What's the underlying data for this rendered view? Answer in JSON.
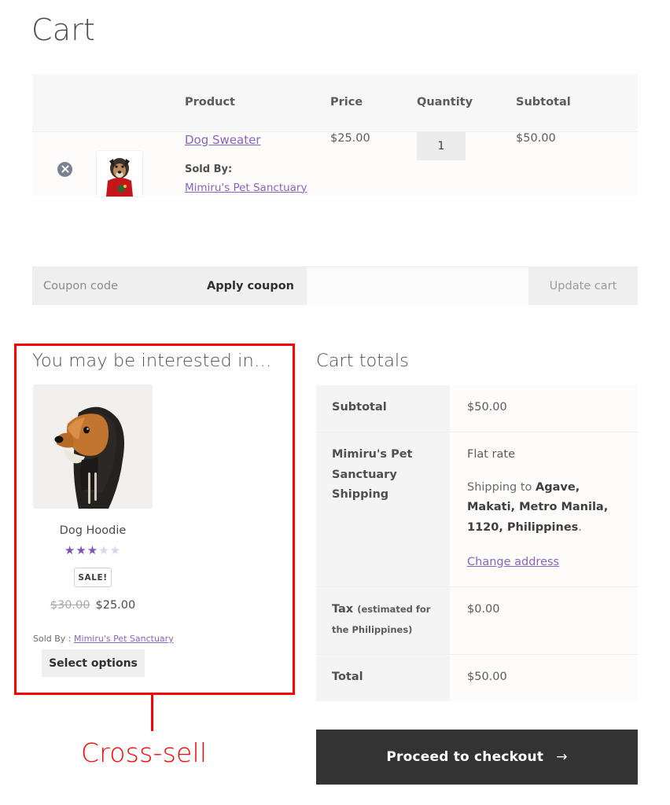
{
  "page": {
    "title": "Cart"
  },
  "cart_table": {
    "headers": [
      "",
      "",
      "Product",
      "Price",
      "Quantity",
      "Subtotal"
    ],
    "row": {
      "remove_icon": "remove-circle-x-icon",
      "thumbnail_alt": "Dog Sweater product thumbnail",
      "product_name": "Dog Sweater",
      "sold_by_label": "Sold By:",
      "vendor": "Mimiru's Pet Sanctuary",
      "price": "$25.00",
      "quantity": "1",
      "subtotal": "$50.00"
    }
  },
  "coupon": {
    "placeholder": "Coupon code",
    "value": "",
    "apply_label": "Apply coupon",
    "update_label": "Update cart"
  },
  "crosssell": {
    "heading": "You may be interested in…",
    "product": {
      "image_alt": "Dog Hoodie product image",
      "name": "Dog Hoodie",
      "rating": 3,
      "rating_max": 5,
      "badge": "SALE!",
      "price_old": "$30.00",
      "price_new": "$25.00",
      "sold_by_prefix": "Sold By : ",
      "vendor": "Mimiru's Pet Sanctuary",
      "button_label": "Select options"
    }
  },
  "annotation": {
    "label": "Cross-sell",
    "color": "#ff0000"
  },
  "totals": {
    "heading": "Cart totals",
    "rows": [
      {
        "label": "Subtotal",
        "value": "$50.00"
      },
      {
        "label": "Mimiru's Pet Sanctuary Shipping",
        "value": "Flat rate"
      },
      {
        "label": "Tax",
        "label_note": "(estimated for the Philippines)",
        "value": "$0.00"
      },
      {
        "label": "Total",
        "value": "$50.00"
      }
    ],
    "shipping": {
      "method": "Flat rate",
      "ship_to_prefix": "Shipping to ",
      "ship_to_address": "Agave, Makati, Metro Manila, 1120, Philippines",
      "ship_to_suffix": ".",
      "change_address_label": "Change address"
    },
    "checkout_label": "Proceed to checkout",
    "checkout_arrow": "→"
  },
  "colors": {
    "link": "#8a63bd",
    "star": "#7f54b3",
    "star_empty": "#ddd4e9",
    "checkout_bg": "#333333",
    "annotation": "#ff0000"
  }
}
